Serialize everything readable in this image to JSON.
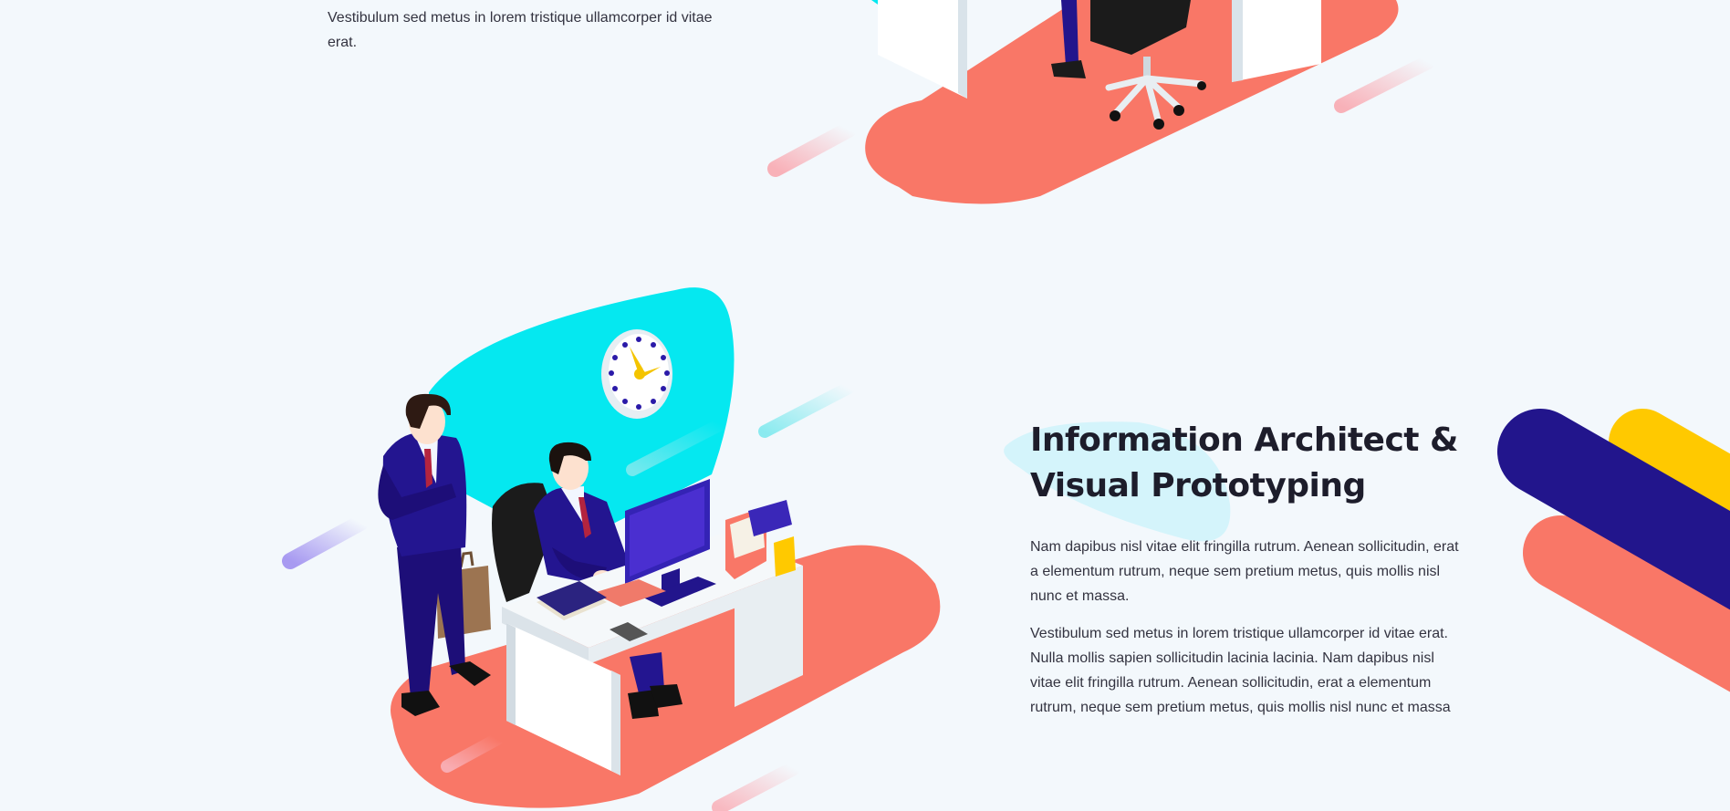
{
  "previous_section": {
    "paragraph": "Vestibulum sed metus in lorem tristique ullamcorper id vitae erat."
  },
  "feature": {
    "title_line1": "Information Architect &",
    "title_line2": "Visual Prototyping",
    "paragraph1": "Nam dapibus nisl vitae elit fringilla rutrum. Aenean sollicitudin, erat a elementum rutrum, neque sem pretium metus, quis mollis nisl nunc et massa.",
    "paragraph2": "Vestibulum sed metus in lorem tristique ullamcorper id vitae erat. Nulla mollis sapien sollicitudin lacinia lacinia. Nam dapibus nisl vitae elit fringilla rutrum. Aenean sollicitudin, erat a elementum rutrum, neque sem pretium metus, quis mollis nisl nunc et massa"
  },
  "colors": {
    "background": "#f3f8fc",
    "coral": "#f97767",
    "cyan": "#05e8f0",
    "navy": "#22158c",
    "yellow": "#ffc900",
    "purple_suit": "#1d0e78"
  }
}
